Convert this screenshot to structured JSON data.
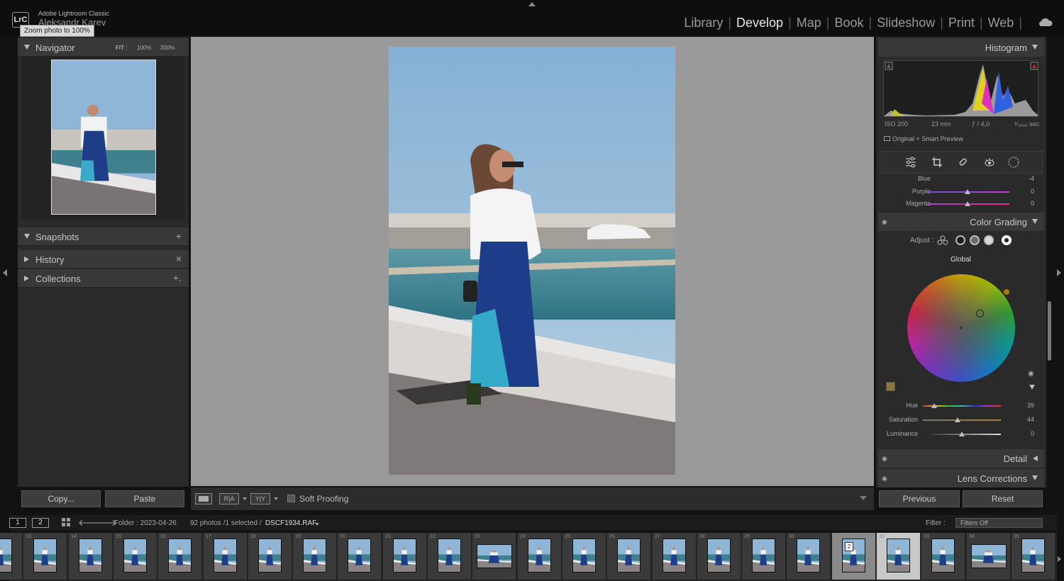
{
  "app": {
    "name": "Adobe Lightroom Classic",
    "user": "Aleksandr Karev",
    "logo": "LrC",
    "tooltip": "Zoom photo to 100%"
  },
  "modules": [
    {
      "label": "Library",
      "active": false
    },
    {
      "label": "Develop",
      "active": true
    },
    {
      "label": "Map",
      "active": false
    },
    {
      "label": "Book",
      "active": false
    },
    {
      "label": "Slideshow",
      "active": false
    },
    {
      "label": "Print",
      "active": false
    },
    {
      "label": "Web",
      "active": false
    }
  ],
  "left": {
    "navigator": {
      "title": "Navigator",
      "fit": "FIT :",
      "z100": "100%",
      "z300": "300%"
    },
    "snapshots": {
      "title": "Snapshots",
      "action": "+"
    },
    "history": {
      "title": "History",
      "action": "×"
    },
    "collections": {
      "title": "Collections",
      "action": "+."
    },
    "copy_label": "Copy...",
    "paste_label": "Paste"
  },
  "toolbar": {
    "view_a": "R|A",
    "view_b": "Y|Y",
    "soft_proofing": "Soft Proofing"
  },
  "right": {
    "histogram": {
      "title": "Histogram",
      "iso": "ISO 200",
      "focal": "23 mm",
      "aperture": "ƒ / 4,0",
      "shutter": "¹⁄₁₆₀₀ sec",
      "preview": "Original + Smart Preview"
    },
    "hsl_rows": [
      {
        "label": "Blue",
        "value": "-4"
      },
      {
        "label": "Purple",
        "value": "0"
      },
      {
        "label": "Magenta",
        "value": "0"
      }
    ],
    "color_grading": {
      "title": "Color Grading",
      "adjust_label": "Adjust :",
      "mode": "Global",
      "sliders": [
        {
          "label": "Hue",
          "value": "39"
        },
        {
          "label": "Saturation",
          "value": "44"
        },
        {
          "label": "Luminance",
          "value": "0"
        }
      ]
    },
    "detail": {
      "title": "Detail"
    },
    "lens": {
      "title": "Lens Corrections"
    },
    "previous_label": "Previous",
    "reset_label": "Reset"
  },
  "filmbar": {
    "view1": "1",
    "view2": "2",
    "folder": "Folder : 2023-04-26",
    "count": "92 photos /1 selected /",
    "file": "DSCF1934.RAF",
    "filter_label": "Filter :",
    "filter_value": "Filters Off"
  },
  "filmstrip": {
    "numbers": [
      "",
      "13",
      "14",
      "15",
      "16",
      "17",
      "18",
      "19",
      "20",
      "21",
      "22",
      "23",
      "24",
      "25",
      "26",
      "27",
      "28",
      "29",
      "30",
      "31",
      "32",
      "33",
      "34",
      "35"
    ],
    "selected_index": 20,
    "primary_index": 19,
    "stack_count": "2"
  },
  "colors": {
    "accent": "#e6e6e6",
    "panel": "#2a2a2a",
    "background": "#121212",
    "grading_swatch": "#8a7444"
  }
}
